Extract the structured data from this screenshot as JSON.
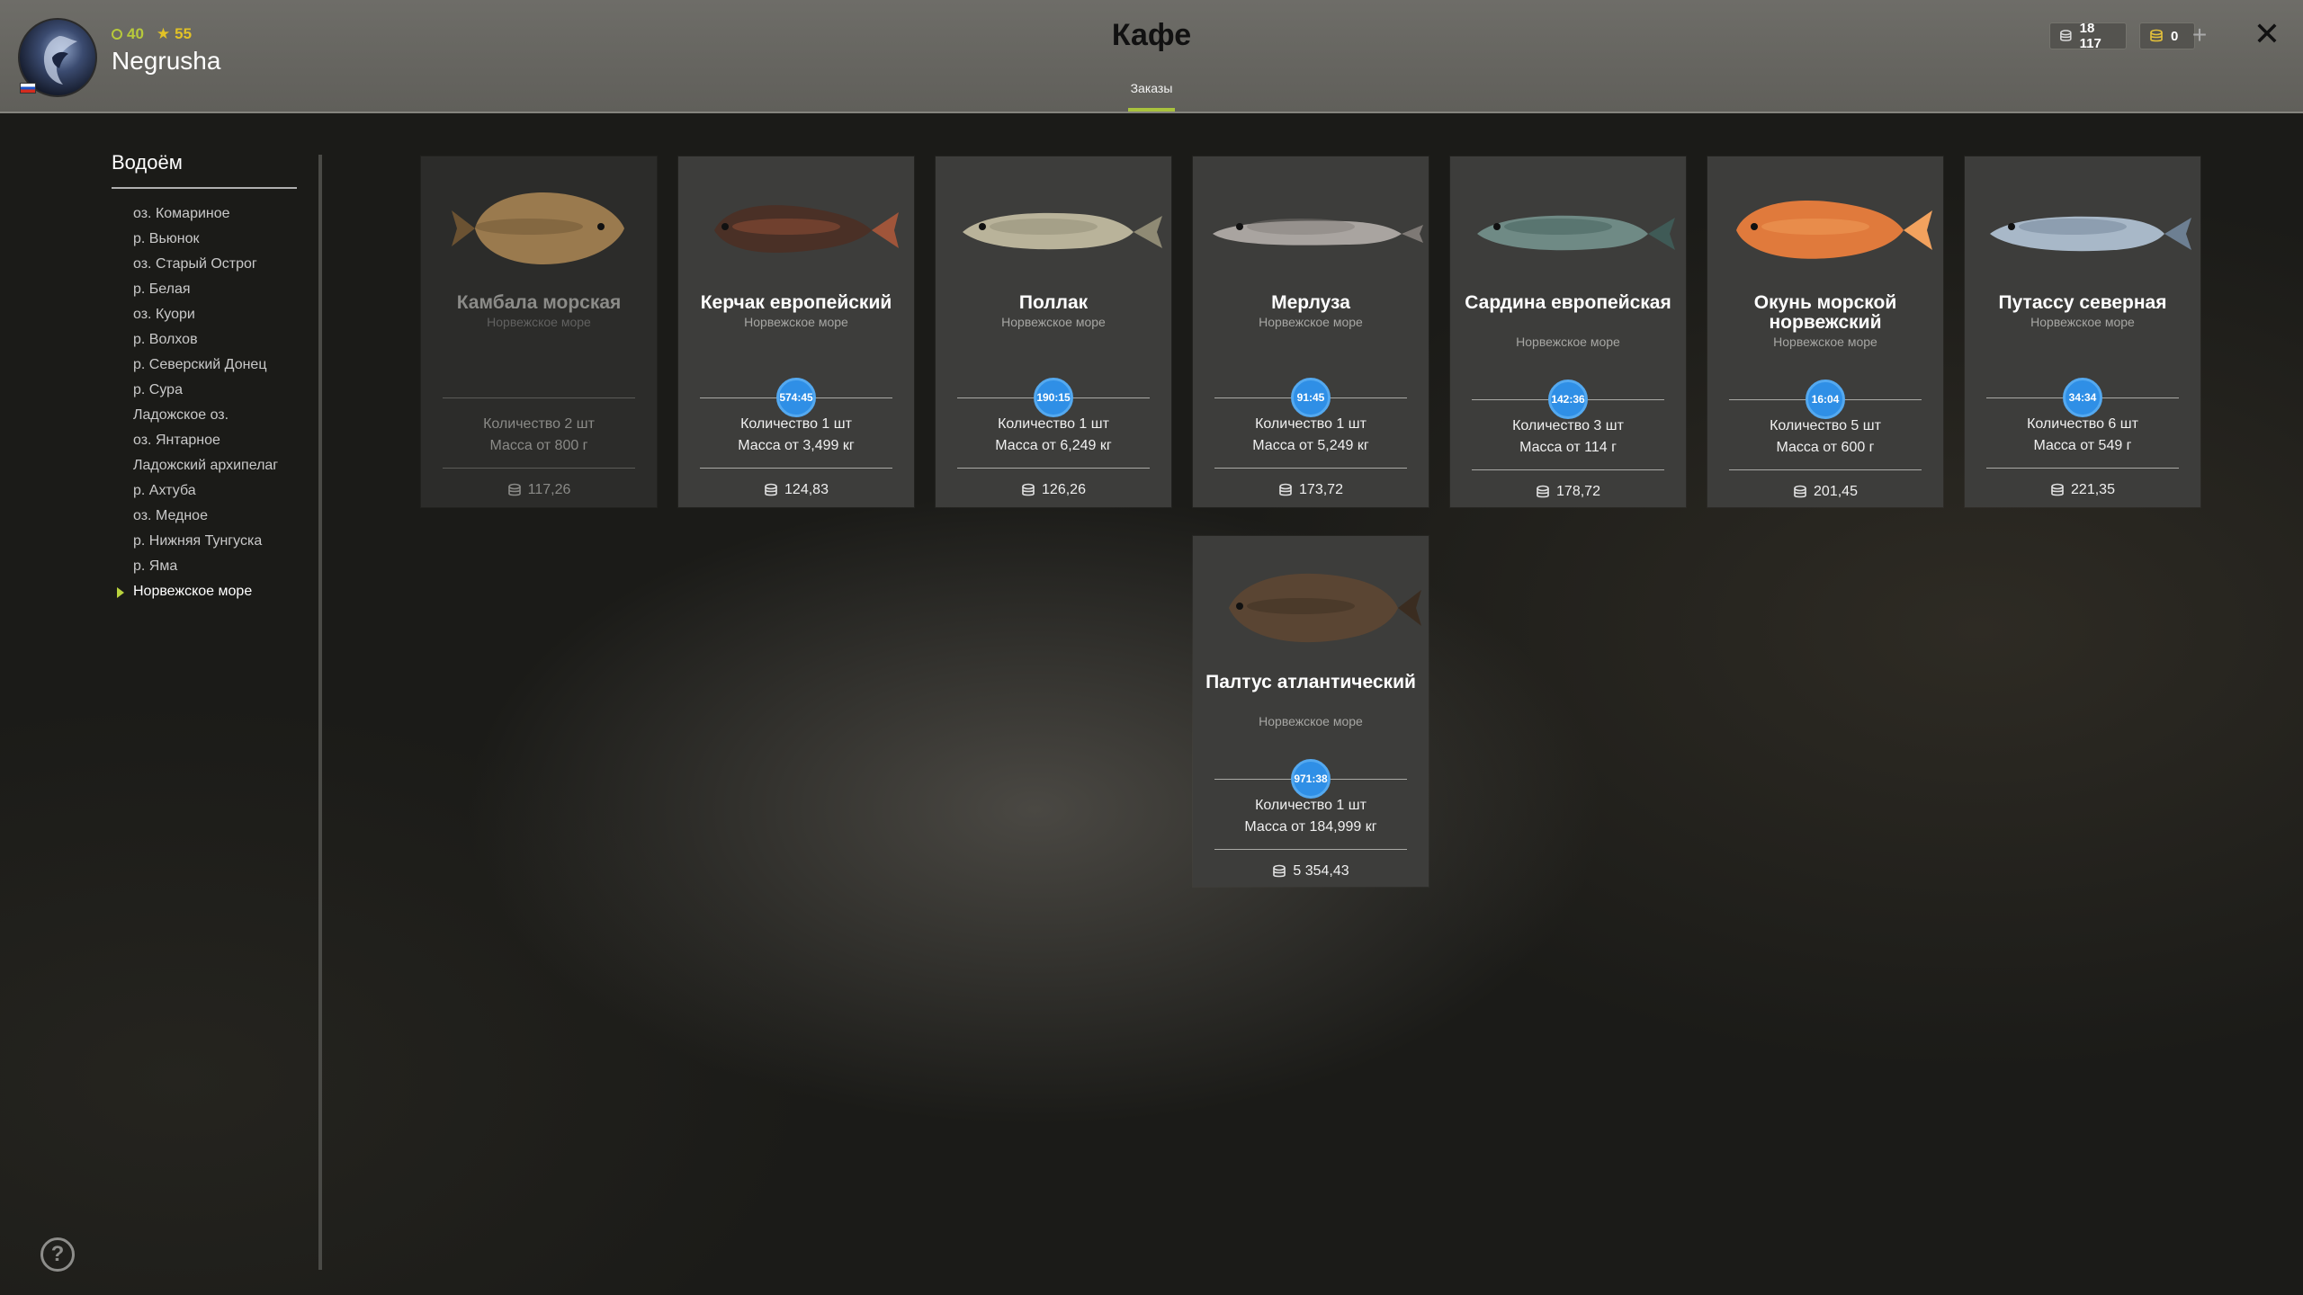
{
  "player": {
    "name": "Negrusha",
    "level": "40",
    "stars": "55"
  },
  "header": {
    "title": "Кафе",
    "tab": "Заказы",
    "silver": "18 117",
    "gold": "0",
    "accent": "#a9c23d"
  },
  "sidebar": {
    "title": "Водоём",
    "items": [
      "оз. Комариное",
      "р. Вьюнок",
      "оз. Старый Острог",
      "р. Белая",
      "оз. Куори",
      "р. Волхов",
      "р. Северский Донец",
      "р. Сура",
      "Ладожское оз.",
      "оз. Янтарное",
      "Ладожский архипелаг",
      "р. Ахтуба",
      "оз. Медное",
      "р. Нижняя Тунгуска",
      "р. Яма",
      "Норвежское море"
    ],
    "active_item": "Норвежское море"
  },
  "orders": [
    {
      "name": "Камбала морская",
      "location": "Норвежское море",
      "timer": "",
      "quantity": "Количество 2 шт",
      "mass": "Масса от 800 г",
      "price": "117,26",
      "available": false,
      "fish_icon": "flounder"
    },
    {
      "name": "Керчак европейский",
      "location": "Норвежское море",
      "timer": "574:45",
      "quantity": "Количество 1 шт",
      "mass": "Масса от 3,499 кг",
      "price": "124,83",
      "available": true,
      "fish_icon": "sculpin"
    },
    {
      "name": "Поллак",
      "location": "Норвежское море",
      "timer": "190:15",
      "quantity": "Количество 1 шт",
      "mass": "Масса от 6,249 кг",
      "price": "126,26",
      "available": true,
      "fish_icon": "pollack"
    },
    {
      "name": "Мерлуза",
      "location": "Норвежское море",
      "timer": "91:45",
      "quantity": "Количество 1 шт",
      "mass": "Масса от 5,249 кг",
      "price": "173,72",
      "available": true,
      "fish_icon": "hake"
    },
    {
      "name": "Сардина европейская",
      "location": "Норвежское море",
      "timer": "142:36",
      "quantity": "Количество 3 шт",
      "mass": "Масса от 114 г",
      "price": "178,72",
      "available": true,
      "fish_icon": "sardine"
    },
    {
      "name": "Окунь морской норвежский",
      "location": "Норвежское море",
      "timer": "16:04",
      "quantity": "Количество 5 шт",
      "mass": "Масса от 600 г",
      "price": "201,45",
      "available": true,
      "fish_icon": "redfish"
    },
    {
      "name": "Путассу северная",
      "location": "Норвежское море",
      "timer": "34:34",
      "quantity": "Количество 6 шт",
      "mass": "Масса от 549 г",
      "price": "221,35",
      "available": true,
      "fish_icon": "whiting"
    },
    {
      "name": "Палтус атлантический",
      "location": "Норвежское море",
      "timer": "971:38",
      "quantity": "Количество 1 шт",
      "mass": "Масса от 184,999 кг",
      "price": "5 354,43",
      "available": true,
      "fish_icon": "halibut"
    }
  ]
}
